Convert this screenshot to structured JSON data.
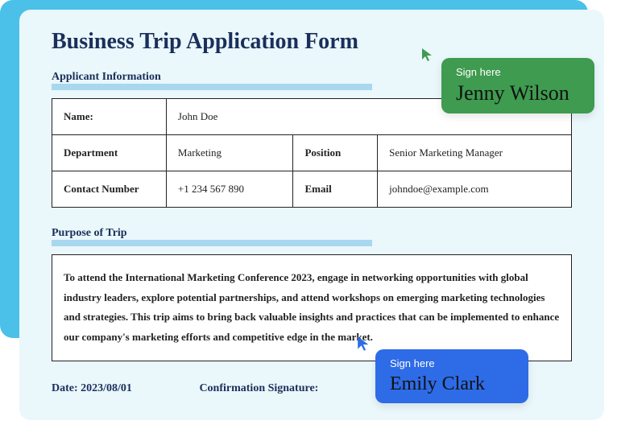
{
  "form": {
    "title": "Business Trip Application Form",
    "sections": {
      "applicant_label": "Applicant Information",
      "purpose_label": "Purpose of Trip"
    },
    "applicant": {
      "name_label": "Name:",
      "name_value": "John Doe",
      "department_label": "Department",
      "department_value": "Marketing",
      "position_label": "Position",
      "position_value": "Senior Marketing Manager",
      "contact_label": "Contact Number",
      "contact_value": "+1 234 567 890",
      "email_label": "Email",
      "email_value": "johndoe@example.com"
    },
    "purpose_text": "To attend the International Marketing Conference 2023, engage in networking opportunities with global industry leaders, explore potential partnerships, and attend workshops on emerging marketing technologies and strategies. This trip aims to bring back valuable insights and practices that can be implemented to enhance our company's marketing efforts and competitive edge in the market.",
    "footer": {
      "date_label": "Date:",
      "date_value": "2023/08/01",
      "sig_label": "Confirmation Signature:"
    }
  },
  "callouts": {
    "sign_here": "Sign here",
    "sig1": "Jenny Wilson",
    "sig2": "Emily Clark"
  },
  "colors": {
    "green": "#3e9b4f",
    "blue": "#2e6be6",
    "bg_light": "#eaf7fb",
    "bg_accent": "#4bc0e8"
  }
}
